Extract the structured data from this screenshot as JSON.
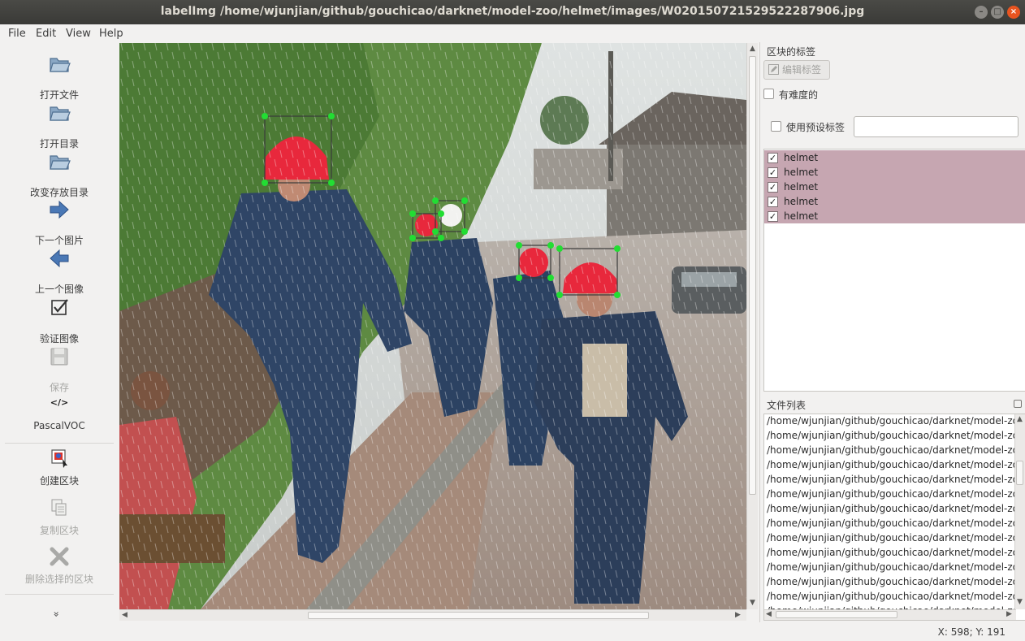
{
  "window": {
    "title": "labelImg /home/wjunjian/github/gouchicao/darknet/model-zoo/helmet/images/W020150721529522287906.jpg",
    "minimize_glyph": "–",
    "maximize_glyph": "□",
    "close_glyph": "×"
  },
  "menu": {
    "file": "File",
    "edit": "Edit",
    "view": "View",
    "help": "Help"
  },
  "toolbar": {
    "open_file": "打开文件",
    "open_dir": "打开目录",
    "change_save_dir": "改变存放目录",
    "next_image": "下一个图片",
    "prev_image": "上一个图像",
    "verify_image": "验证图像",
    "save": "保存",
    "format_icon_text": "</>",
    "format": "PascalVOC",
    "create_box": "创建区块",
    "duplicate_box": "复制区块",
    "delete_box": "删除选择的区块",
    "more": "»"
  },
  "dock": {
    "box_labels_title": "区块的标签",
    "edit_label_button": "编辑标签",
    "difficult_label": "有难度的",
    "use_default_label": "使用预设标签",
    "default_label_value": "",
    "labels": [
      "helmet",
      "helmet",
      "helmet",
      "helmet",
      "helmet"
    ],
    "check_glyph": "✓",
    "file_list_title": "文件列表",
    "files": [
      "/home/wjunjian/github/gouchicao/darknet/model-zoo",
      "/home/wjunjian/github/gouchicao/darknet/model-zoo",
      "/home/wjunjian/github/gouchicao/darknet/model-zoo",
      "/home/wjunjian/github/gouchicao/darknet/model-zoo",
      "/home/wjunjian/github/gouchicao/darknet/model-zoo",
      "/home/wjunjian/github/gouchicao/darknet/model-zoo",
      "/home/wjunjian/github/gouchicao/darknet/model-zoo",
      "/home/wjunjian/github/gouchicao/darknet/model-zoo",
      "/home/wjunjian/github/gouchicao/darknet/model-zoo",
      "/home/wjunjian/github/gouchicao/darknet/model-zoo",
      "/home/wjunjian/github/gouchicao/darknet/model-zoo",
      "/home/wjunjian/github/gouchicao/darknet/model-zoo",
      "/home/wjunjian/github/gouchicao/darknet/model-zoo",
      "/home/wjunjian/github/gouchicao/darknet/model-zoo"
    ]
  },
  "status": {
    "coords": "X: 598; Y: 191"
  },
  "colors": {
    "selected_label_bg": "#c6a6b1",
    "box_handle": "#22dd33",
    "helmet_red": "#e8283c",
    "titlebar_close": "#e95420"
  },
  "icons": {
    "open_file": "folder-icon",
    "open_dir": "folder-icon",
    "change_save_dir": "folder-icon",
    "next_image": "arrow-right-icon",
    "prev_image": "arrow-left-icon",
    "verify_image": "checkbox-icon",
    "save": "floppy-disk-icon",
    "format": "code-icon",
    "create_box": "draw-box-icon",
    "duplicate_box": "copy-icon",
    "delete_box": "cross-icon"
  }
}
